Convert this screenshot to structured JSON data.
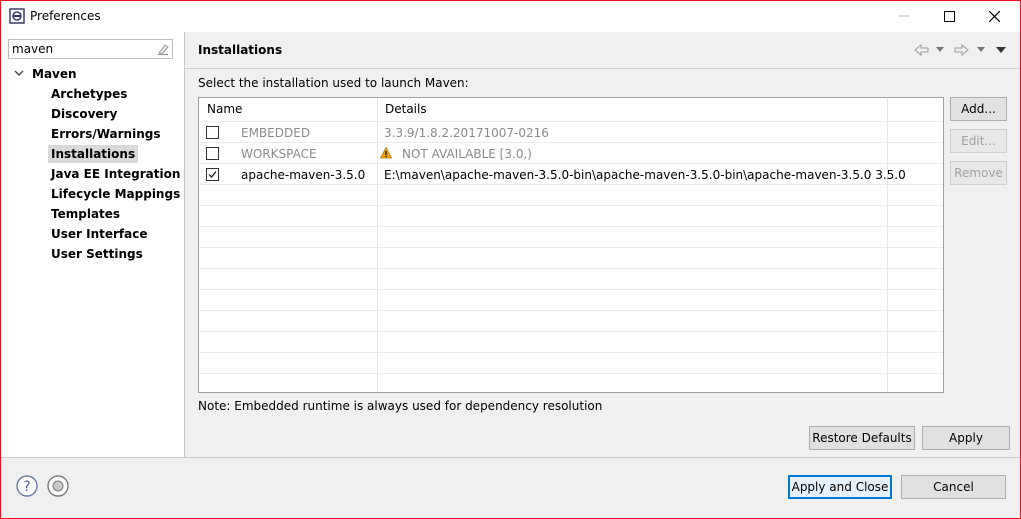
{
  "window": {
    "title": "Preferences"
  },
  "filter": {
    "value": "maven"
  },
  "tree": {
    "root": "Maven",
    "children": [
      "Archetypes",
      "Discovery",
      "Errors/Warnings",
      "Installations",
      "Java EE Integration",
      "Lifecycle Mappings",
      "Templates",
      "User Interface",
      "User Settings"
    ],
    "selected": "Installations"
  },
  "page": {
    "title": "Installations",
    "intro": "Select the installation used to launch Maven:",
    "note": "Note: Embedded runtime is always used for dependency resolution"
  },
  "table": {
    "columns": [
      "Name",
      "Details"
    ],
    "rows": [
      {
        "name": "EMBEDDED",
        "details": "3.3.9/1.8.2.20171007-0216",
        "checked": false,
        "disabled": true,
        "warning": false
      },
      {
        "name": "WORKSPACE",
        "details": "NOT AVAILABLE [3.0,)",
        "checked": false,
        "disabled": true,
        "warning": true
      },
      {
        "name": "apache-maven-3.5.0",
        "details": "E:\\maven\\apache-maven-3.5.0-bin\\apache-maven-3.5.0-bin\\apache-maven-3.5.0 3.5.0",
        "checked": true,
        "disabled": false,
        "warning": false
      }
    ]
  },
  "side_buttons": {
    "add": "Add...",
    "edit": "Edit...",
    "remove": "Remove"
  },
  "buttons": {
    "restore_defaults": "Restore Defaults",
    "apply": "Apply",
    "apply_and_close": "Apply and Close",
    "cancel": "Cancel"
  },
  "icons": {
    "help": "help-icon",
    "import_export": "import-export-icon",
    "warning": "warning-icon",
    "back": "back-arrow-icon",
    "forward": "forward-arrow-icon",
    "menu": "view-menu-icon"
  },
  "colors": {
    "selection": "#cce8ff",
    "focus_border": "#0078d7",
    "window_border": "#e81123",
    "warning": "#f0a30a"
  }
}
